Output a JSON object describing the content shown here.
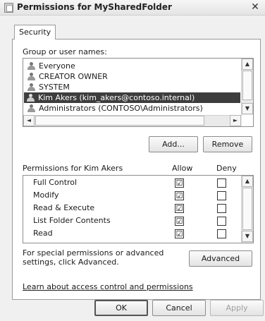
{
  "window": {
    "title": "Permissions for MySharedFolder",
    "close_glyph": "✕"
  },
  "tab": {
    "label": "Security"
  },
  "group": {
    "label": "Group or user names:",
    "users": [
      {
        "name": "Everyone",
        "icon": "group-icon",
        "selected": false
      },
      {
        "name": "CREATOR OWNER",
        "icon": "group-icon",
        "selected": false
      },
      {
        "name": "SYSTEM",
        "icon": "group-icon",
        "selected": false
      },
      {
        "name": "Kim Akers (kim_akers@contoso.internal)",
        "icon": "user-icon",
        "selected": true
      },
      {
        "name": "Administrators (CONTOSO\\Administrators)",
        "icon": "group-icon",
        "selected": false
      }
    ]
  },
  "buttons": {
    "add": "Add...",
    "remove": "Remove",
    "advanced": "Advanced",
    "ok": "OK",
    "cancel": "Cancel",
    "apply": "Apply"
  },
  "permissions": {
    "label": "Permissions for Kim Akers",
    "allow_header": "Allow",
    "deny_header": "Deny",
    "rows": [
      {
        "name": "Full Control",
        "allow": true,
        "deny": false
      },
      {
        "name": "Modify",
        "allow": true,
        "deny": false
      },
      {
        "name": "Read & Execute",
        "allow": true,
        "deny": false
      },
      {
        "name": "List Folder Contents",
        "allow": true,
        "deny": false
      },
      {
        "name": "Read",
        "allow": true,
        "deny": false
      }
    ]
  },
  "advanced_text": "For special permissions or advanced settings, click Advanced.",
  "link_text": "Learn about access control and permissions",
  "glyphs": {
    "check": "☑",
    "unchecked": "☐",
    "up": "▲",
    "down": "▼",
    "left": "◄",
    "right": "►"
  }
}
